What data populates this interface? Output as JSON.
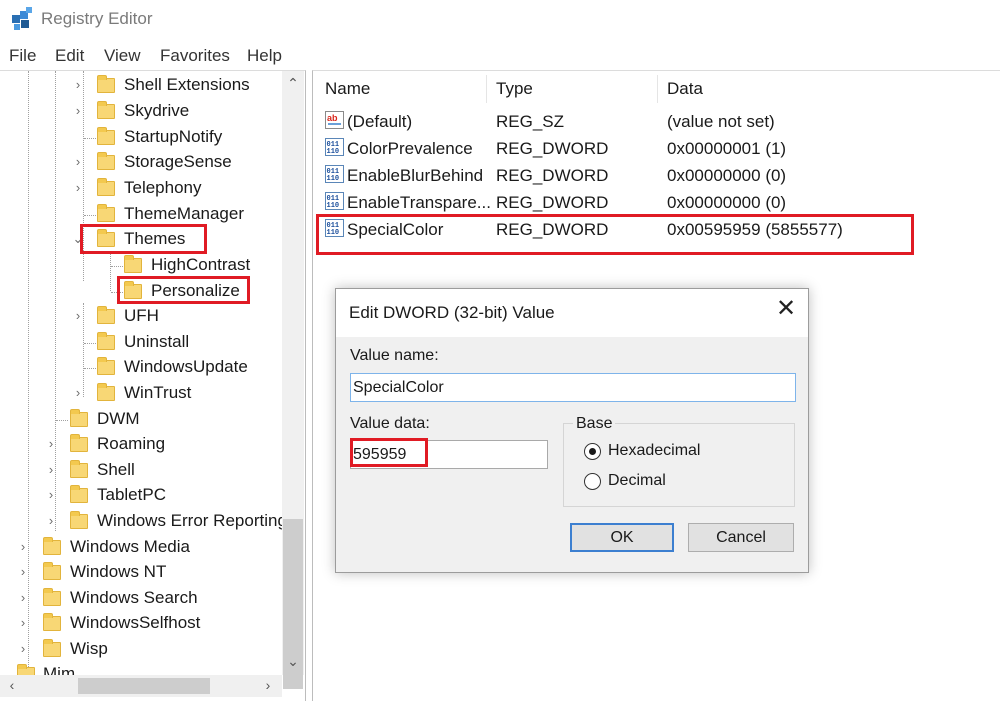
{
  "window": {
    "title": "Registry Editor",
    "icon": "registry-icon"
  },
  "menu": [
    "File",
    "Edit",
    "View",
    "Favorites",
    "Help"
  ],
  "tree": {
    "items": [
      {
        "label": "Shell Extensions",
        "expander": "›"
      },
      {
        "label": "Skydrive",
        "expander": "›"
      },
      {
        "label": "StartupNotify",
        "expander": ""
      },
      {
        "label": "StorageSense",
        "expander": "›"
      },
      {
        "label": "Telephony",
        "expander": "›"
      },
      {
        "label": "ThemeManager",
        "expander": ""
      },
      {
        "label": "Themes",
        "expander": "⌄"
      },
      {
        "label": "HighContrast",
        "expander": ""
      },
      {
        "label": "Personalize",
        "expander": ""
      },
      {
        "label": "UFH",
        "expander": "›"
      },
      {
        "label": "Uninstall",
        "expander": ""
      },
      {
        "label": "WindowsUpdate",
        "expander": ""
      },
      {
        "label": "WinTrust",
        "expander": "›"
      },
      {
        "label": "DWM",
        "expander": ""
      },
      {
        "label": "Roaming",
        "expander": "›"
      },
      {
        "label": "Shell",
        "expander": "›"
      },
      {
        "label": "TabletPC",
        "expander": "›"
      },
      {
        "label": "Windows Error Reporting",
        "expander": "›"
      },
      {
        "label": "Windows Media",
        "expander": "›"
      },
      {
        "label": "Windows NT",
        "expander": "›"
      },
      {
        "label": "Windows Search",
        "expander": "›"
      },
      {
        "label": "WindowsSelfhost",
        "expander": "›"
      },
      {
        "label": "Wisp",
        "expander": "›"
      },
      {
        "label": "Mim",
        "expander": ""
      }
    ]
  },
  "list": {
    "columns": [
      "Name",
      "Type",
      "Data"
    ],
    "rows": [
      {
        "icon": "string-value-icon",
        "name": "(Default)",
        "type": "REG_SZ",
        "data": "(value not set)"
      },
      {
        "icon": "dword-value-icon",
        "name": "ColorPrevalence",
        "type": "REG_DWORD",
        "data": "0x00000001 (1)"
      },
      {
        "icon": "dword-value-icon",
        "name": "EnableBlurBehind",
        "type": "REG_DWORD",
        "data": "0x00000000 (0)"
      },
      {
        "icon": "dword-value-icon",
        "name": "EnableTranspare...",
        "type": "REG_DWORD",
        "data": "0x00000000 (0)"
      },
      {
        "icon": "dword-value-icon",
        "name": "SpecialColor",
        "type": "REG_DWORD",
        "data": "0x00595959 (5855577)"
      }
    ]
  },
  "dialog": {
    "title": "Edit DWORD (32-bit) Value",
    "value_name_label": "Value name:",
    "value_name": "SpecialColor",
    "value_data_label": "Value data:",
    "value_data": "595959",
    "base_label": "Base",
    "base_options": [
      "Hexadecimal",
      "Decimal"
    ],
    "base_selected": "Hexadecimal",
    "ok_label": "OK",
    "cancel_label": "Cancel"
  },
  "colors": {
    "highlight": "#e01b24",
    "folder": "#f8d775",
    "accent": "#3c7fd0"
  }
}
